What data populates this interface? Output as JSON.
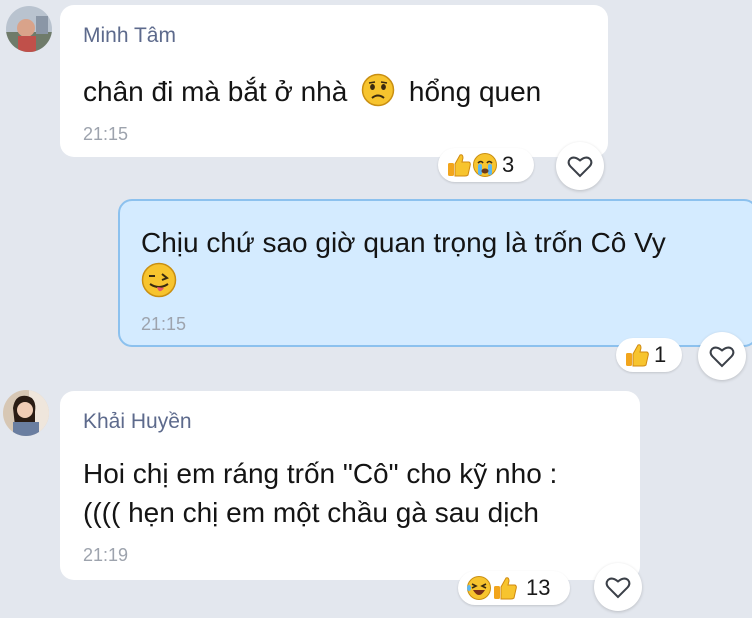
{
  "messages": [
    {
      "sender": "Minh Tâm",
      "text_before": "chân đi mà bắt ở nhà",
      "emoji": "sad-face-emoji",
      "text_after": "hổng quen",
      "time": "21:15",
      "reactions": [
        "thumbs-up-emoji",
        "crying-face-emoji"
      ],
      "reaction_count": "3"
    },
    {
      "text": "Chịu chứ sao giờ quan trọng là trốn Cô Vy",
      "emoji": "tongue-face-emoji",
      "time": "21:15",
      "reactions": [
        "thumbs-up-emoji"
      ],
      "reaction_count": "1"
    },
    {
      "sender": "Khải Huyền",
      "line1": "Hoi chị em ráng trốn \"Cô\" cho kỹ nho :",
      "line2": "(((( hẹn chị em một chầu gà sau dịch",
      "time": "21:19",
      "reactions": [
        "laughing-face-emoji",
        "thumbs-up-emoji"
      ],
      "reaction_count": "13"
    }
  ],
  "colors": {
    "background": "#e3e7ee",
    "incoming_bubble": "#ffffff",
    "outgoing_bubble": "#d4ebff",
    "outgoing_border": "#8cc1ee",
    "sender_name": "#5d6a8c",
    "timestamp": "#9da3ad",
    "emoji_yellow": "#f7c42e"
  }
}
